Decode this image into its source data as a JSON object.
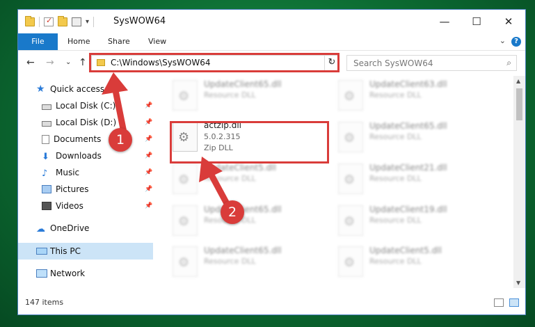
{
  "window": {
    "title": "SysWOW64",
    "controls": {
      "minimize": "—",
      "maximize": "☐",
      "close": "✕"
    }
  },
  "ribbon": {
    "tabs": [
      "File",
      "Home",
      "Share",
      "View"
    ],
    "help": "?"
  },
  "address_bar": {
    "path": "C:\\Windows\\SysWOW64",
    "dropdown": "⌄",
    "refresh": "↻"
  },
  "nav": {
    "back": "←",
    "forward": "→",
    "recent": "⌄",
    "up": "↑"
  },
  "search": {
    "placeholder": "Search SysWOW64",
    "icon": "⌕"
  },
  "sidebar": {
    "items": [
      {
        "label": "Quick access",
        "icon": "star-icon",
        "pinned": false
      },
      {
        "label": "Local Disk (C:)",
        "icon": "disk-icon",
        "pinned": true
      },
      {
        "label": "Local Disk (D:)",
        "icon": "disk-icon",
        "pinned": true
      },
      {
        "label": "Documents",
        "icon": "documents-icon",
        "pinned": true
      },
      {
        "label": "Downloads",
        "icon": "download-icon",
        "pinned": true
      },
      {
        "label": "Music",
        "icon": "music-icon",
        "pinned": true
      },
      {
        "label": "Pictures",
        "icon": "pictures-icon",
        "pinned": true
      },
      {
        "label": "Videos",
        "icon": "videos-icon",
        "pinned": true
      },
      {
        "label": "OneDrive",
        "icon": "cloud-icon",
        "pinned": false
      },
      {
        "label": "This PC",
        "icon": "computer-icon",
        "pinned": false,
        "selected": true
      },
      {
        "label": "Network",
        "icon": "network-icon",
        "pinned": false
      }
    ]
  },
  "files": {
    "highlighted": {
      "name": "actzip.dll",
      "version": "5.0.2.315",
      "type": "Zip DLL"
    },
    "blurred": [
      {
        "name": "UpdateClient65.dll",
        "type": "Resource DLL"
      },
      {
        "name": "UpdateClient63.dll",
        "type": "Resource DLL"
      },
      {
        "name": "UpdateClient65.dll",
        "type": "Resource DLL"
      },
      {
        "name": "UpdateClient5.dll",
        "type": "Resource DLL"
      },
      {
        "name": "UpdateClient21.dll",
        "type": "Resource DLL"
      },
      {
        "name": "UpdateClient65.dll",
        "type": "Resource DLL"
      },
      {
        "name": "UpdateClient19.dll",
        "type": "Resource DLL"
      },
      {
        "name": "UpdateClient65.dll",
        "type": "Resource DLL"
      },
      {
        "name": "UpdateClient5.dll",
        "type": "Resource DLL"
      }
    ]
  },
  "status": {
    "item_count": "147 items"
  },
  "annotations": {
    "step1": "1",
    "step2": "2",
    "color": "#d93c3a"
  }
}
